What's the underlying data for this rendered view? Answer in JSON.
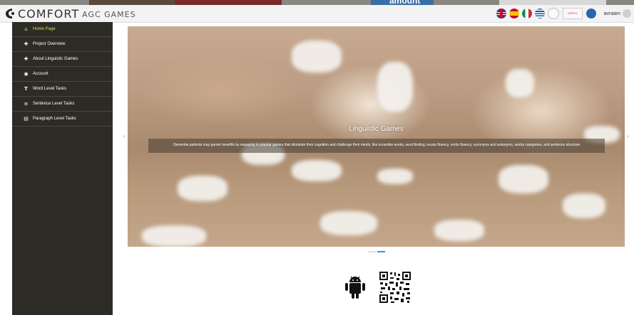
{
  "top_strip": {
    "amount_text": "amount"
  },
  "header": {
    "logo_main": "COMFORT",
    "logo_sub": "AGC GAMES",
    "languages": [
      "english-flag-icon",
      "spanish-flag-icon",
      "italian-flag-icon",
      "greek-flag-icon"
    ],
    "partner_logos": [
      "partner-logo-1",
      "certh-logo",
      "partner-logo-3"
    ],
    "partner_certh_text": "CERTH",
    "username": "avraam"
  },
  "sidebar": {
    "items": [
      {
        "label": "Home Page",
        "icon": "home-icon",
        "active": true
      },
      {
        "label": "Project Overview",
        "icon": "puzzle-icon",
        "active": false
      },
      {
        "label": "About Linguistic Games",
        "icon": "puzzle-icon",
        "active": false
      },
      {
        "label": "Account",
        "icon": "user-circle-icon",
        "active": false
      },
      {
        "label": "Word Level Tasks",
        "icon": "text-size-icon",
        "active": false
      },
      {
        "label": "Sentence Level Tasks",
        "icon": "lines-icon",
        "active": false
      },
      {
        "label": "Paragraph Level Tasks",
        "icon": "document-icon",
        "active": false
      }
    ]
  },
  "carousel": {
    "title": "Linguistic Games",
    "caption": "Dementia patients may garner benefits by engaging in popular games that stimulate their cognition and challenge their minds, like scramble words, word finding, nouns fluency, verbs fluency, synonyms and antonyms, words categories, and sentence structure",
    "prev_label": "‹",
    "next_label": "›",
    "slides": 2,
    "active_slide": 2
  },
  "downloads": {
    "android_icon": "android-icon",
    "qr_icon": "qr-code-icon"
  },
  "colors": {
    "sidebar_bg": "#2c2b26",
    "active_accent": "#d6e24a",
    "indicator_active": "#3a8fd3"
  }
}
